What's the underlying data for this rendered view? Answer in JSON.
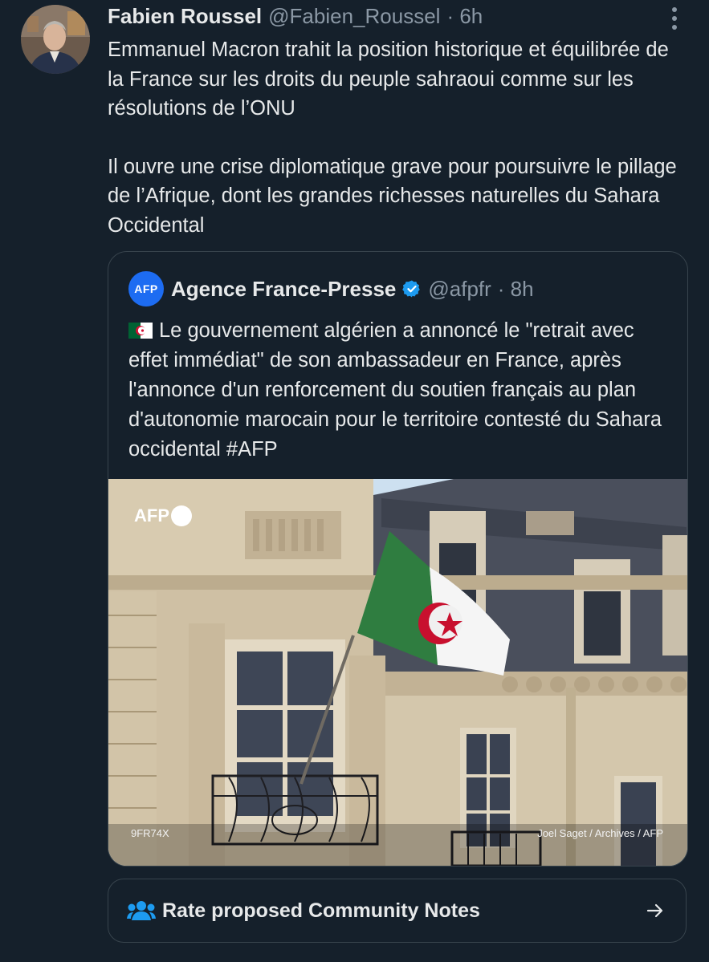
{
  "tweet": {
    "author_name": "Fabien Roussel",
    "author_handle": "@Fabien_Roussel",
    "time": "· 6h",
    "paragraphs": [
      "Emmanuel Macron trahit la position historique et équilibrée de la France sur les droits du peuple sahraoui comme sur les résolutions de l’ONU",
      "Il ouvre une crise diplomatique grave pour poursuivre le pillage de l’Afrique, dont les grandes richesses naturelles du Sahara Occidental"
    ]
  },
  "quote": {
    "avatar_text": "AFP",
    "author_name": "Agence France-Presse",
    "author_handle": "@afpfr",
    "time": "· 8h",
    "text": "Le gouvernement algérien a annoncé le \"retrait avec effet immédiat\" de son ambassadeur en France, après l'annonce d'un renforcement du soutien français au plan d'autonomie marocain pour le territoire contesté du Sahara occidental #AFP",
    "photo": {
      "logo_text": "AFP",
      "id_text": "9FR74X",
      "credit_text": "Joel Saget / Archives / AFP"
    }
  },
  "community_notes": {
    "label": "Rate proposed Community Notes"
  },
  "icons": {
    "more": "more-vertical-icon",
    "verified": "verified-badge-icon",
    "flag": "algeria-flag-emoji",
    "notes": "people-icon",
    "arrow": "arrow-right-icon"
  },
  "colors": {
    "background": "#15202b",
    "text": "#e7e9ea",
    "secondary_text": "#8b98a5",
    "border": "#38444d",
    "verified_blue": "#1d9bf0",
    "notes_icon": "#1d9bf0"
  }
}
